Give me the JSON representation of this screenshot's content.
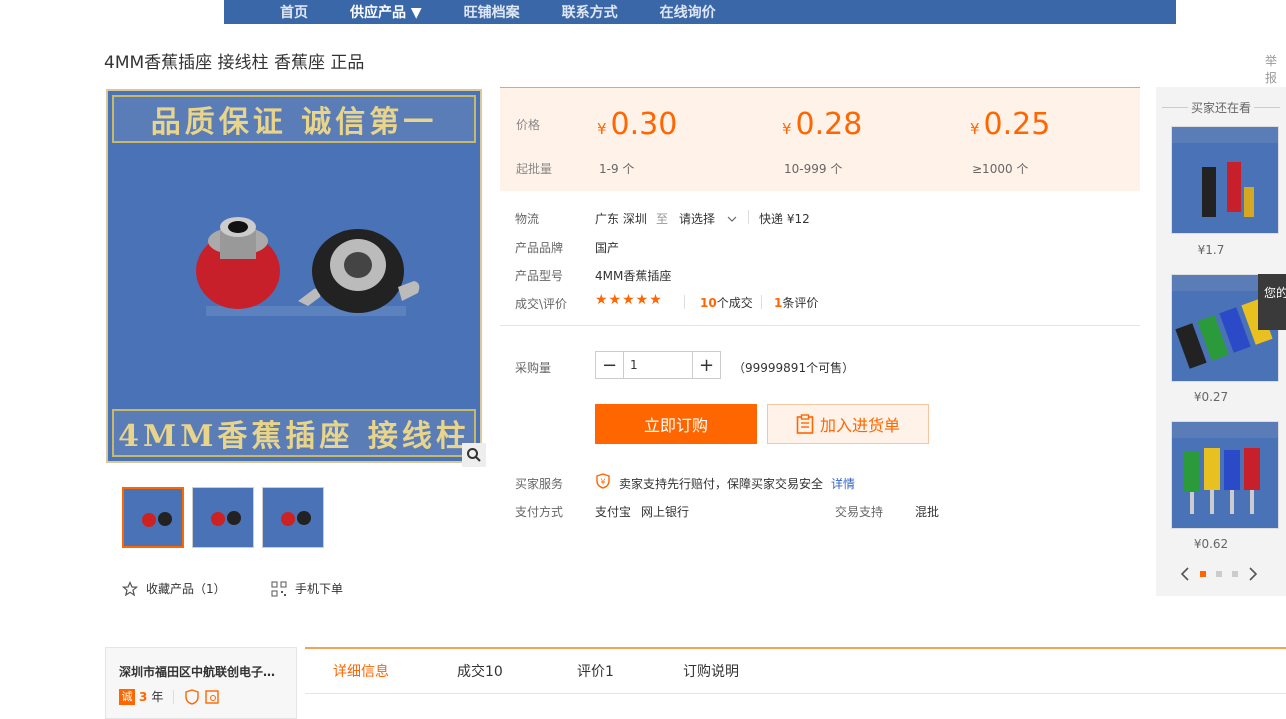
{
  "nav": {
    "items": [
      "首页",
      "供应产品 ▼",
      "旺铺档案",
      "联系方式",
      "在线询价"
    ],
    "active_index": 1
  },
  "product": {
    "title": "4MM香蕉插座 接线柱 香蕉座 正品",
    "report_label": "举报",
    "image_top_text": "品质保证 诚信第一",
    "image_bottom_text": "4MM香蕉插座 接线柱"
  },
  "price": {
    "price_label": "价格",
    "qty_label": "起批量",
    "currency": "¥",
    "tiers": [
      {
        "price": "0.30",
        "qty": "1-9 个"
      },
      {
        "price": "0.28",
        "qty": "10-999 个"
      },
      {
        "price": "0.25",
        "qty": "≥1000 个"
      }
    ]
  },
  "logistics": {
    "label": "物流",
    "from": "广东 深圳",
    "to_word": "至",
    "select_text": "请选择",
    "express": "快递 ¥12"
  },
  "brand": {
    "label": "产品品牌",
    "value": "国产"
  },
  "model": {
    "label": "产品型号",
    "value": "4MM香蕉插座"
  },
  "deals": {
    "label": "成交\\评价",
    "rating": 5,
    "deal_count": "10",
    "deal_suffix": "个成交",
    "review_count": "1",
    "review_suffix": "条评价"
  },
  "purchase": {
    "label": "采购量",
    "quantity": "1",
    "available": "（99999891个可售）",
    "buy_label": "立即订购",
    "cart_label": "加入进货单"
  },
  "service": {
    "label": "买家服务",
    "text": "卖家支持先行赔付，保障买家交易安全",
    "detail_link": "详情"
  },
  "payment": {
    "label": "支付方式",
    "methods": [
      "支付宝",
      "网上银行"
    ],
    "trade_label": "交易支持",
    "trade_value": "混批"
  },
  "actions": {
    "favorite": "收藏产品（1）",
    "mobile": "手机下单"
  },
  "sidebar": {
    "title": "买家还在看",
    "items": [
      {
        "price": "¥1.7"
      },
      {
        "price": "¥0.27"
      },
      {
        "price": "¥0.62"
      }
    ],
    "float_text": "您的"
  },
  "company": {
    "name": "深圳市福田区中航联创电子…",
    "years": "3",
    "years_suffix": "年"
  },
  "tabs": [
    "详细信息",
    "成交10",
    "评价1",
    "订购说明"
  ],
  "colors": {
    "accent": "#ff6600",
    "nav": "#3a67a8"
  }
}
